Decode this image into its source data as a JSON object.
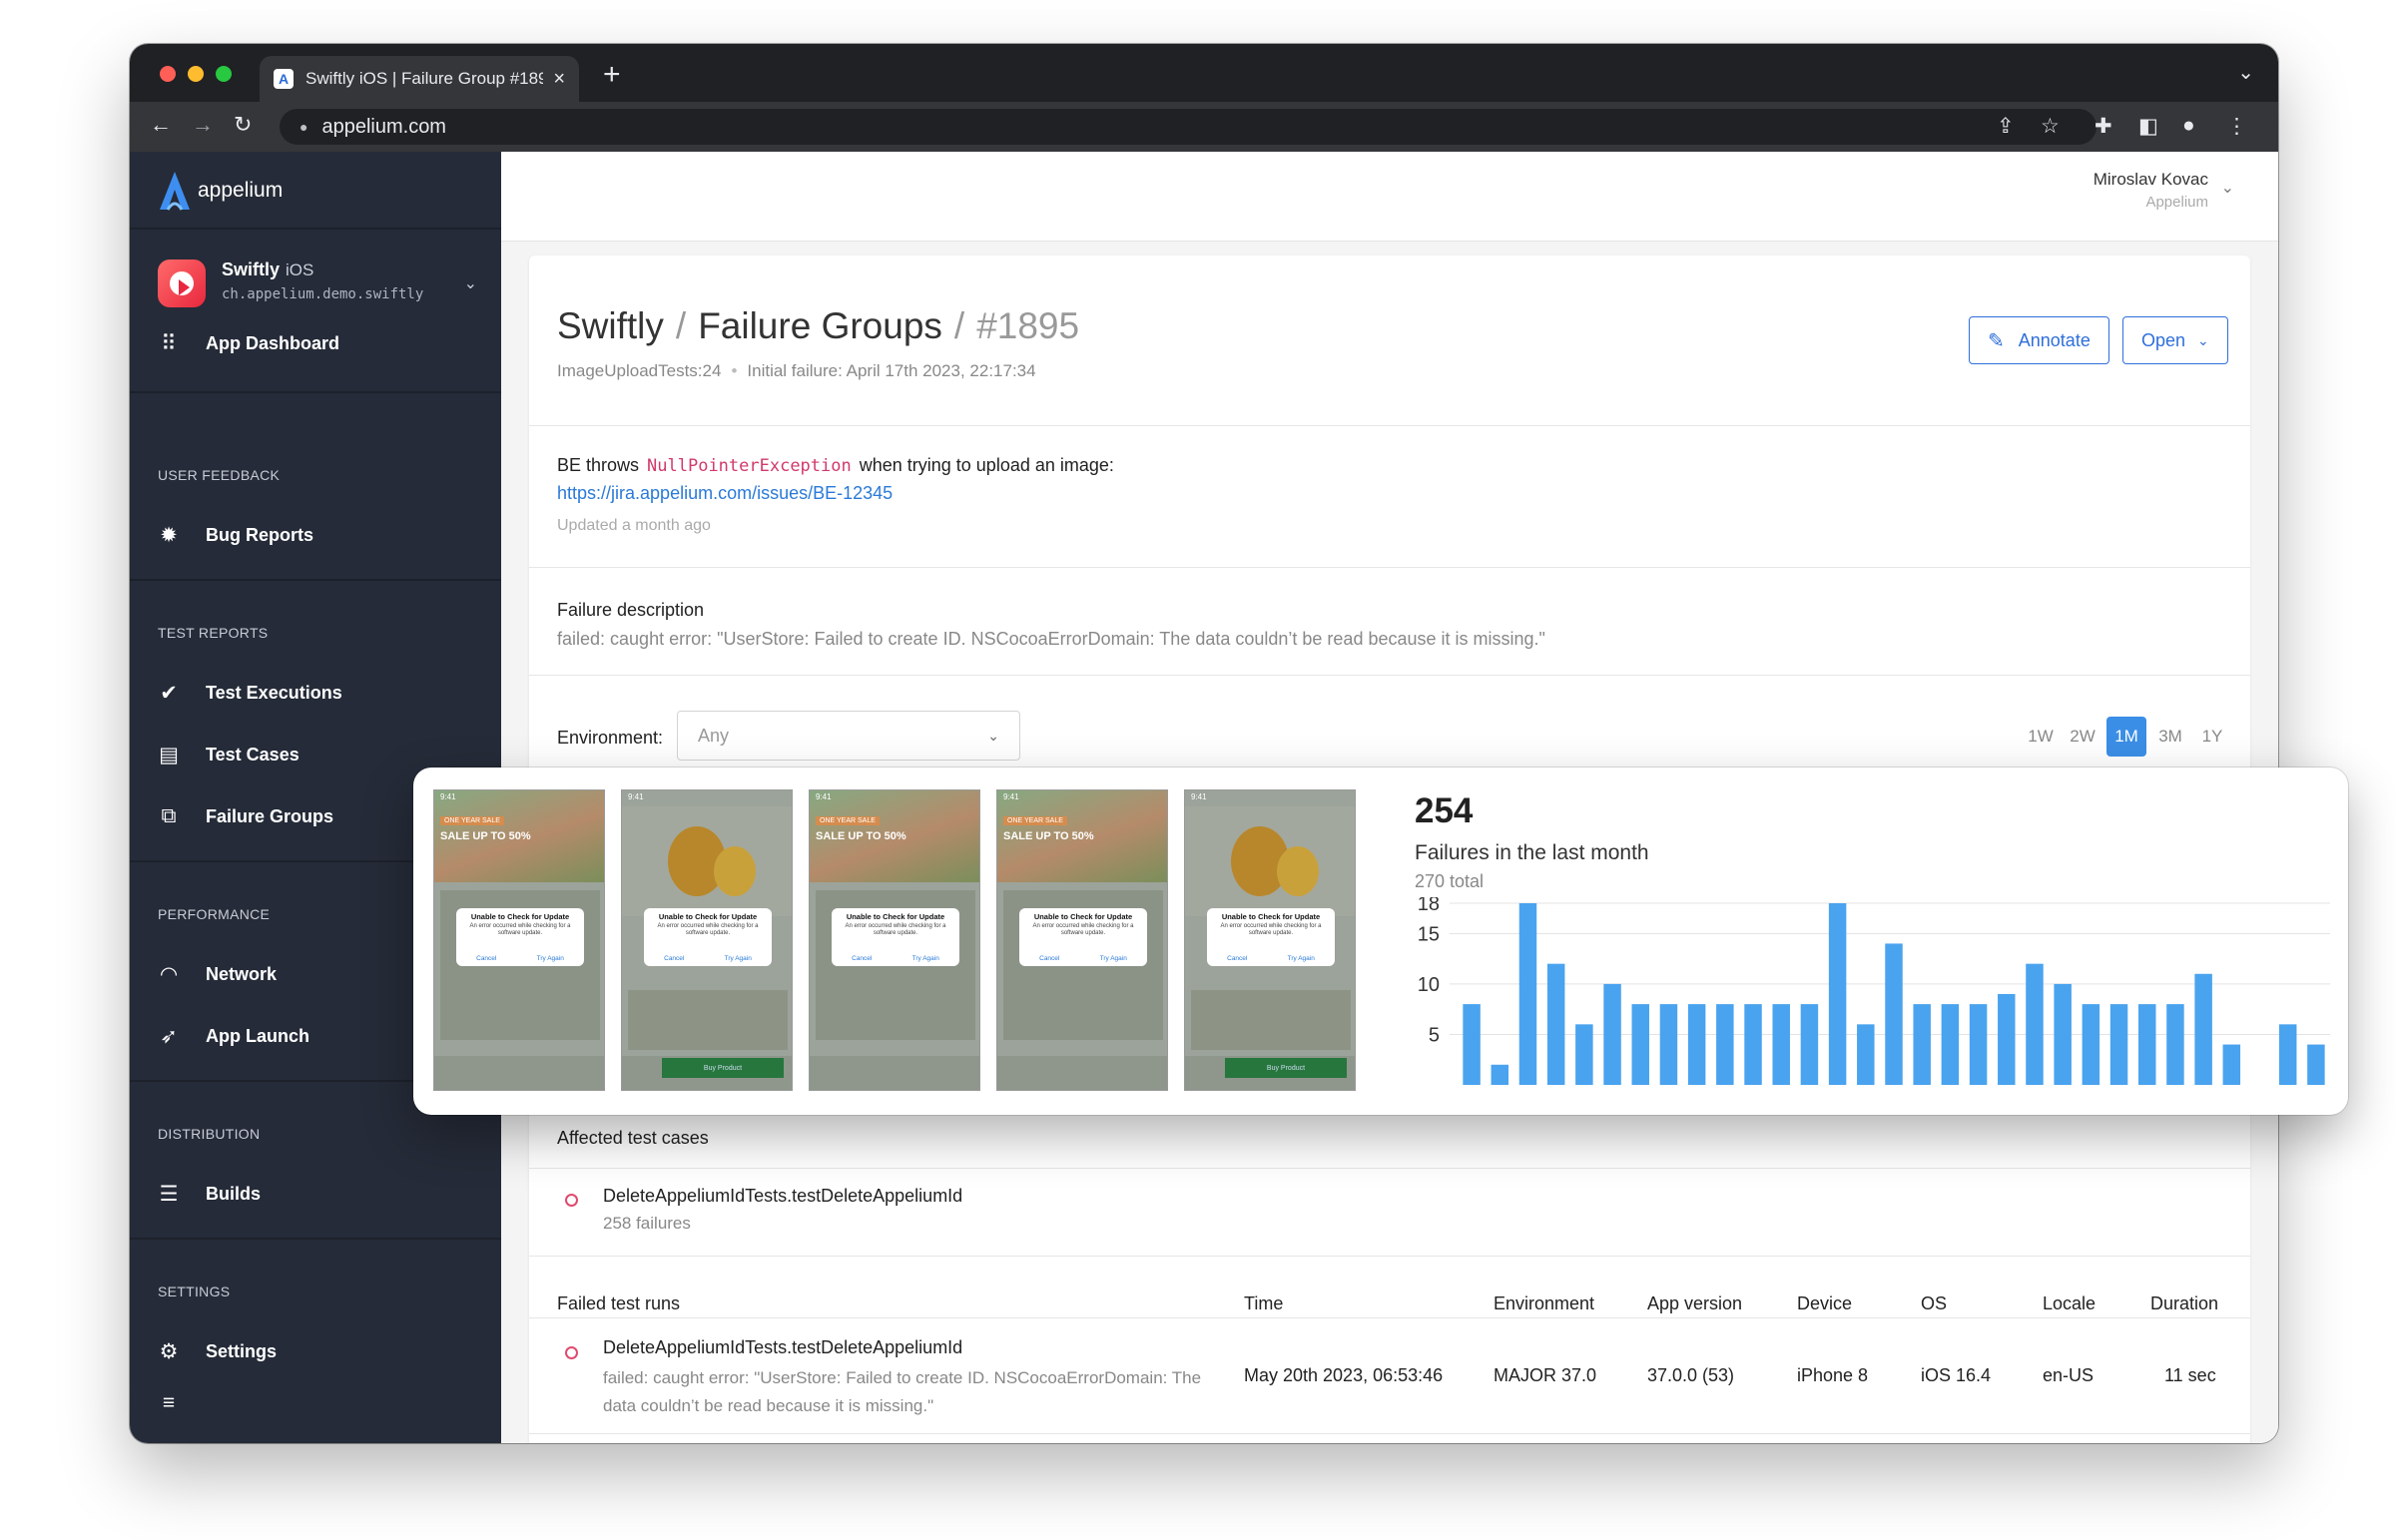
{
  "browser": {
    "tab_title": "Swiftly iOS | Failure Group #1895",
    "favicon": "A",
    "url": "appelium.com",
    "traffic_lights": [
      "#ff5f57",
      "#febc2e",
      "#28c840"
    ]
  },
  "sidebar": {
    "brand": "appelium",
    "app": {
      "name": "Swiftly",
      "platform": "iOS",
      "bundle": "ch.appelium.demo.swiftly"
    },
    "dashboard_label": "App Dashboard",
    "sections": {
      "user_feedback": "USER FEEDBACK",
      "test_reports": "TEST REPORTS",
      "performance": "PERFORMANCE",
      "distribution": "DISTRIBUTION",
      "settings": "SETTINGS"
    },
    "items": {
      "bug_reports": "Bug Reports",
      "test_executions": "Test Executions",
      "test_cases": "Test Cases",
      "failure_groups": "Failure Groups",
      "network": "Network",
      "app_launch": "App Launch",
      "builds": "Builds",
      "settings": "Settings"
    }
  },
  "user": {
    "name": "Miroslav Kovac",
    "org": "Appelium"
  },
  "header": {
    "crumb_app": "Swiftly",
    "crumb_section": "Failure Groups",
    "crumb_id": "#1895",
    "test_ref": "ImageUploadTests:24",
    "initial_failure": "Initial failure: April 17th 2023, 22:17:34",
    "annotate_label": "Annotate",
    "open_label": "Open"
  },
  "annotation": {
    "before": "BE throws",
    "code": "NullPointerException",
    "after": "when trying to upload an image:",
    "link": "https://jira.appelium.com/issues/BE-12345",
    "updated": "Updated a month ago"
  },
  "failure_description": {
    "title": "Failure description",
    "text": "failed: caught error: \"UserStore: Failed to create ID. NSCocoaErrorDomain: The data couldn’t be read because it is missing.\""
  },
  "filters": {
    "environment_label": "Environment:",
    "environment_value": "Any",
    "ranges": [
      "1W",
      "2W",
      "1M",
      "3M",
      "1Y"
    ],
    "active_range": "1M"
  },
  "overlay": {
    "screenshots": [
      {
        "kind": "sale",
        "time": "9:41",
        "tag": "ONE YEAR SALE",
        "headline": "SALE UP TO 50%",
        "dialog_title": "Unable to Check for Update",
        "dialog_msg": "An error occurred while checking for a software update.",
        "cancel": "Cancel",
        "retry": "Try Again"
      },
      {
        "kind": "prod",
        "time": "9:41",
        "dialog_title": "Unable to Check for Update",
        "dialog_msg": "An error occurred while checking for a software update.",
        "cancel": "Cancel",
        "retry": "Try Again",
        "buy": "Buy Product"
      },
      {
        "kind": "sale",
        "time": "9:41",
        "tag": "ONE YEAR SALE",
        "headline": "SALE UP TO 50%",
        "dialog_title": "Unable to Check for Update",
        "dialog_msg": "An error occurred while checking for a software update.",
        "cancel": "Cancel",
        "retry": "Try Again"
      },
      {
        "kind": "sale",
        "time": "9:41",
        "tag": "ONE YEAR SALE",
        "headline": "SALE UP TO 50%",
        "dialog_title": "Unable to Check for Update",
        "dialog_msg": "An error occurred while checking for a software update.",
        "cancel": "Cancel",
        "retry": "Try Again"
      },
      {
        "kind": "prod",
        "time": "9:41",
        "dialog_title": "Unable to Check for Update",
        "dialog_msg": "An error occurred while checking for a software update.",
        "cancel": "Cancel",
        "retry": "Try Again",
        "buy": "Buy Product"
      }
    ],
    "count": "254",
    "count_label": "Failures in the last month",
    "total": "270 total"
  },
  "chart_data": {
    "type": "bar",
    "title": "",
    "xlabel": "",
    "ylabel": "",
    "yticks": [
      5,
      10,
      15,
      18
    ],
    "ylim": [
      0,
      18
    ],
    "color": "#4aa3ef",
    "values": [
      8,
      2,
      18,
      12,
      6,
      10,
      8,
      8,
      8,
      8,
      8,
      8,
      8,
      18,
      6,
      14,
      8,
      8,
      8,
      9,
      12,
      10,
      8,
      8,
      8,
      8,
      11,
      4,
      0,
      6,
      4
    ]
  },
  "affected": {
    "title": "Affected test cases",
    "test_name": "DeleteAppeliumIdTests.testDeleteAppeliumId",
    "failures": "258 failures"
  },
  "runs": {
    "headers": [
      "Failed test runs",
      "Time",
      "Environment",
      "App version",
      "Device",
      "OS",
      "Locale",
      "Duration"
    ],
    "row": {
      "name": "DeleteAppeliumIdTests.testDeleteAppeliumId",
      "error": "failed: caught error: \"UserStore: Failed to create ID. NSCocoaErrorDomain: The data couldn’t be read because it is missing.\"",
      "time": "May 20th 2023, 06:53:46",
      "environment": "MAJOR 37.0",
      "app_version": "37.0.0 (53)",
      "device": "iPhone 8",
      "os": "iOS 16.4",
      "locale": "en-US",
      "duration": "11 sec"
    }
  }
}
